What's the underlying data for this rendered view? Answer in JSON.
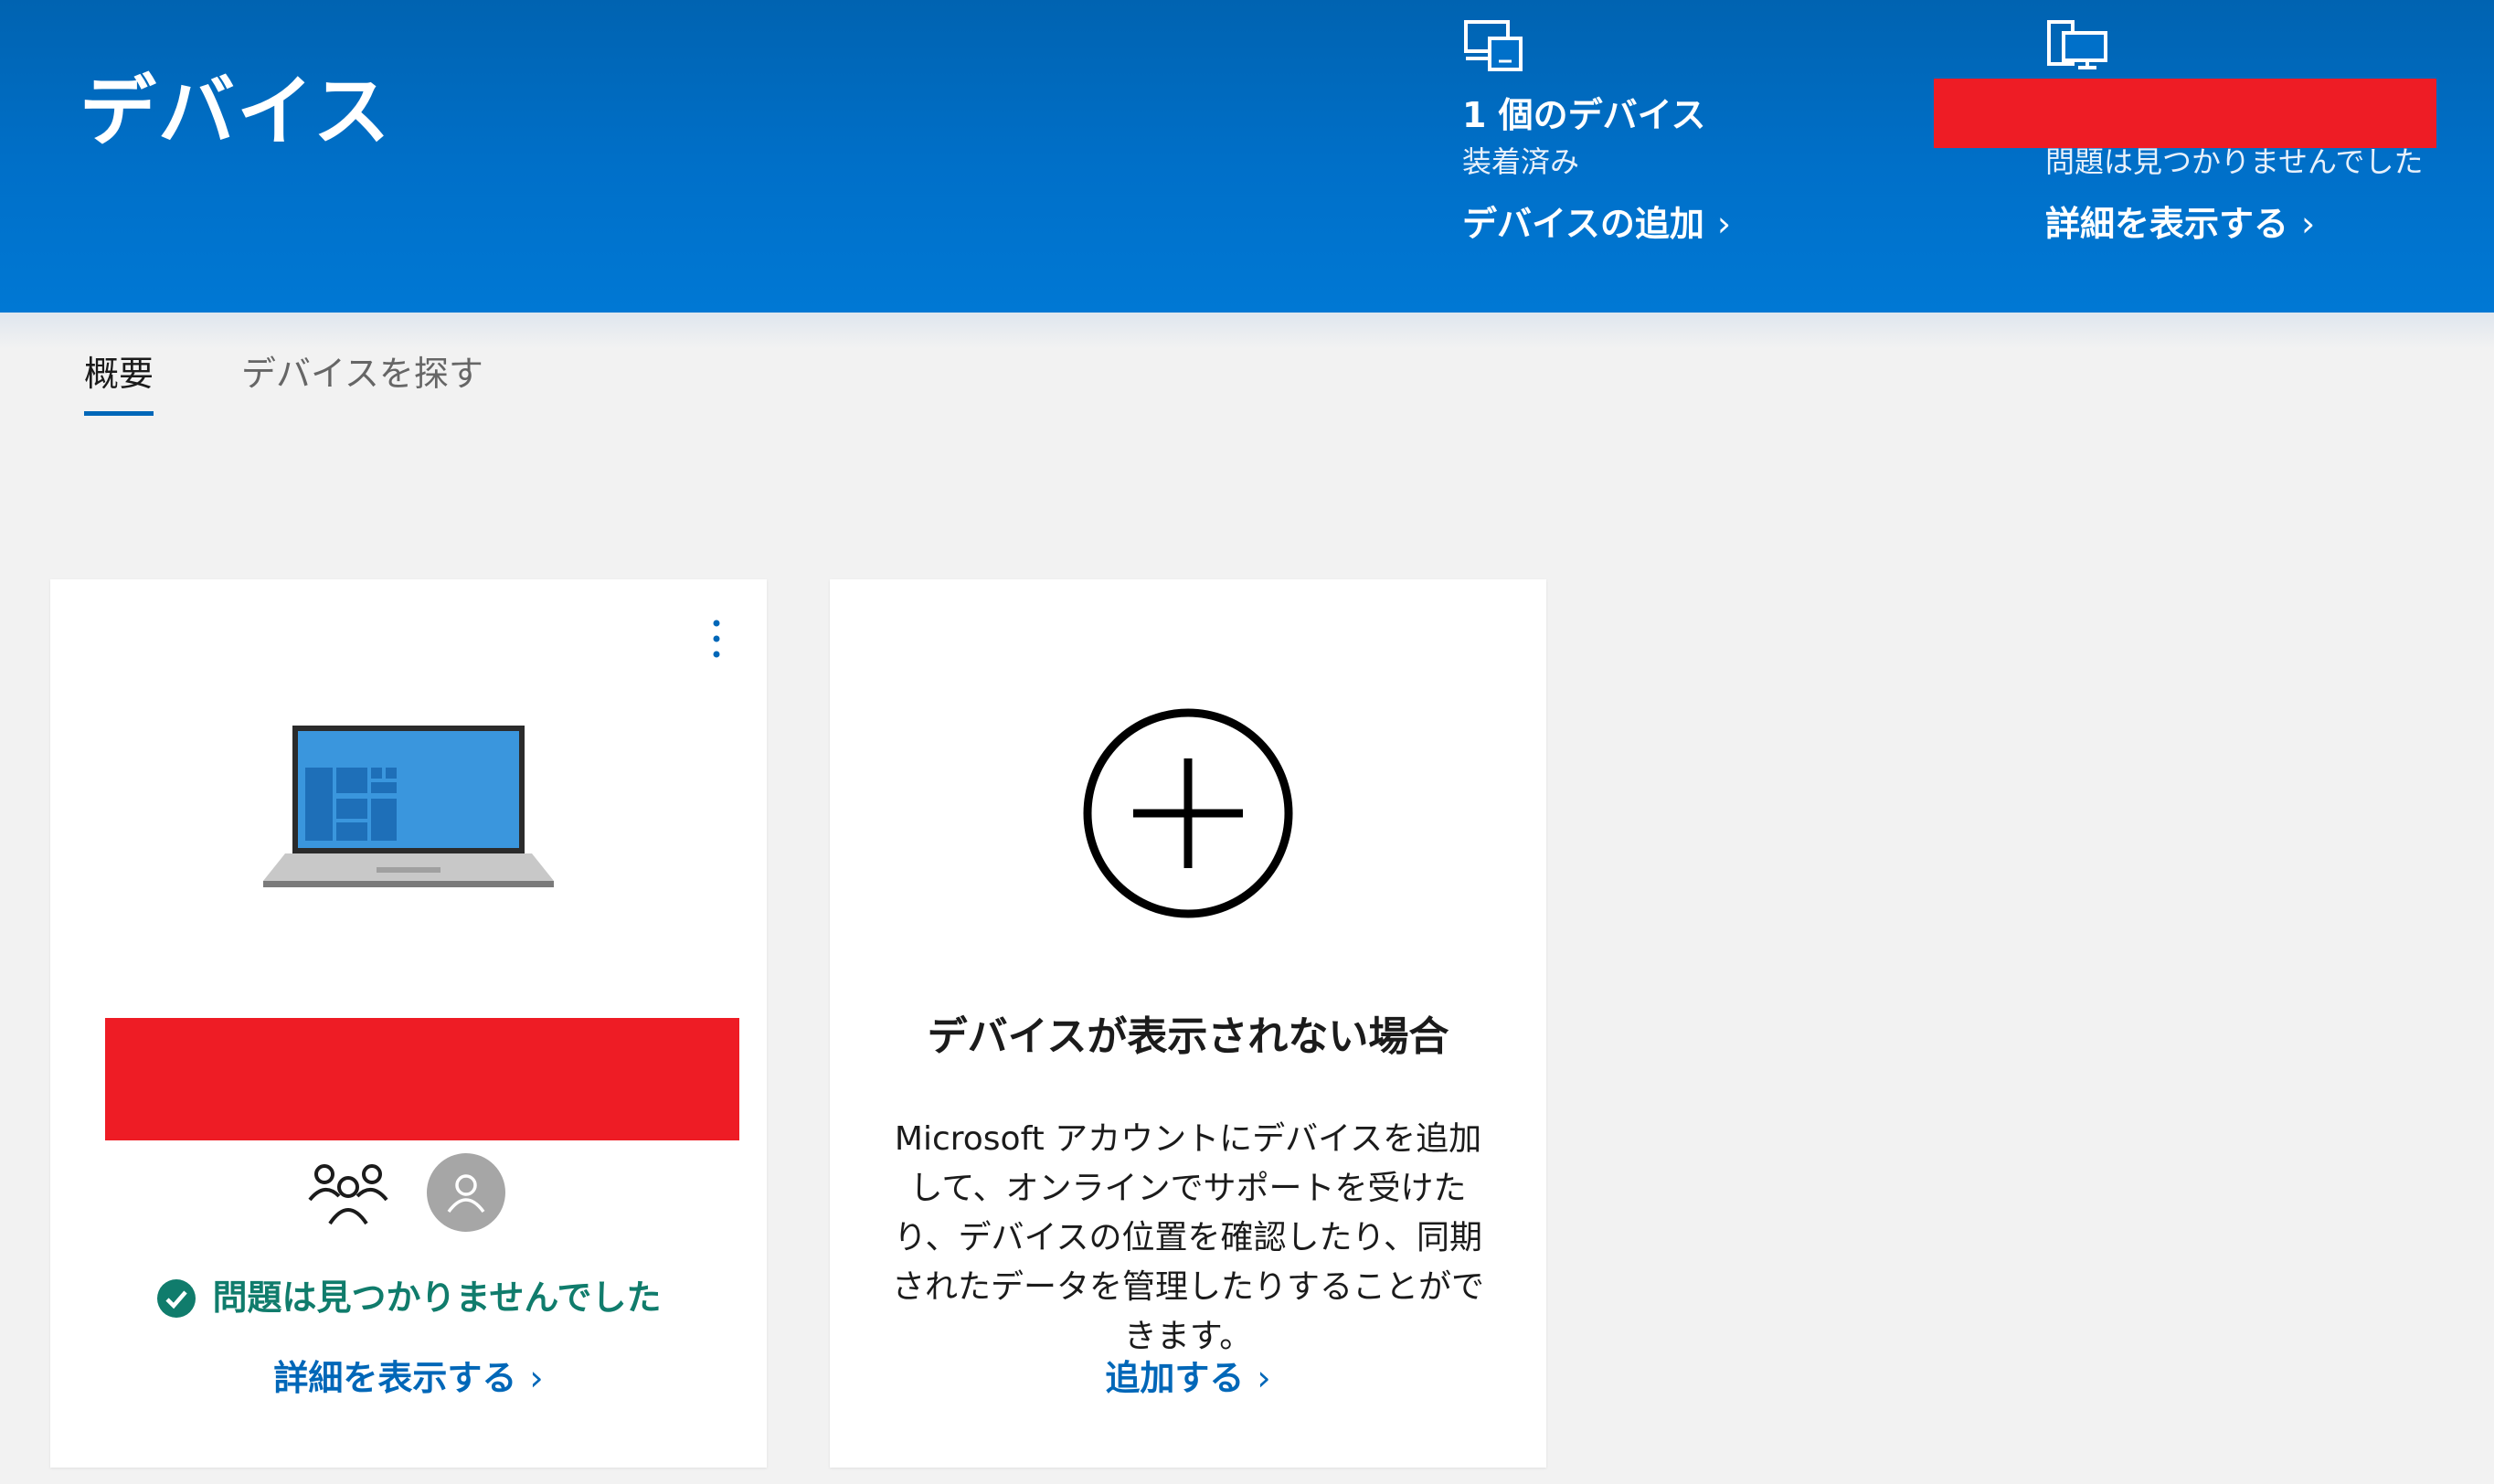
{
  "header": {
    "title": "デバイス",
    "devices": {
      "count_label": "1 個のデバイス",
      "sub_label": "装着済み",
      "link": "デバイスの追加",
      "icon": "devices-icon"
    },
    "status": {
      "sub_label": "問題は見つかりませんでした",
      "link": "詳細を表示する",
      "icon": "device-monitor-icon"
    },
    "chevron": "›"
  },
  "tabs": [
    {
      "label": "概要",
      "active": true
    },
    {
      "label": "デバイスを探す",
      "active": false
    }
  ],
  "device_card": {
    "status_text": "問題は見つかりませんでした",
    "link": "詳細を表示する",
    "status_color": "#107c6c"
  },
  "add_card": {
    "title": "デバイスが表示されない場合",
    "description": "Microsoft アカウントにデバイスを追加して、オンラインでサポートを受けたり、デバイスの位置を確認したり、同期されたデータを管理したりすることができます。",
    "link": "追加する"
  },
  "colors": {
    "header": "#0078d4",
    "accent": "#0067b8",
    "redaction": "#ee1c25"
  }
}
